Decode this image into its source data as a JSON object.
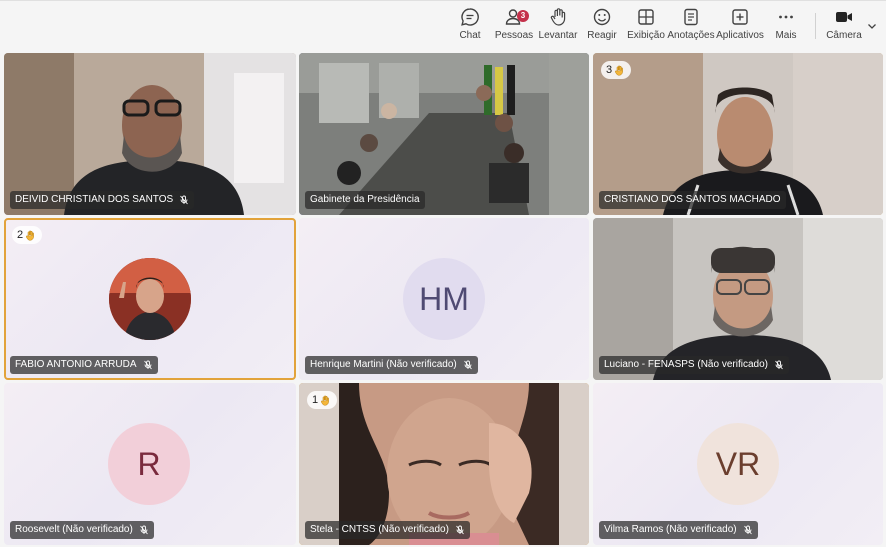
{
  "toolbar": {
    "chat": "Chat",
    "people": "Pessoas",
    "people_badge": "3",
    "raise": "Levantar",
    "react": "Reagir",
    "view": "Exibição",
    "notes": "Anotações",
    "apps": "Aplicativos",
    "more": "Mais",
    "camera": "Câmera"
  },
  "participants": [
    {
      "name": "DEIVID CHRISTIAN DOS SANTOS",
      "muted": true
    },
    {
      "name": "Gabinete da Presidência",
      "muted": false
    },
    {
      "name": "CRISTIANO DOS SANTOS MACHADO",
      "muted": false,
      "raised_hand": "3"
    },
    {
      "name": "FABIO ANTONIO ARRUDA",
      "muted": true,
      "raised_hand": "2"
    },
    {
      "name": "Henrique Martini (Não verificado)",
      "muted": true,
      "initials": "HM"
    },
    {
      "name": "Luciano - FENASPS (Não verificado)",
      "muted": true
    },
    {
      "name": "Roosevelt (Não verificado)",
      "muted": true,
      "initials": "R"
    },
    {
      "name": "Stela - CNTSS (Não verificado)",
      "muted": true,
      "raised_hand": "1"
    },
    {
      "name": "Vilma Ramos (Não verificado)",
      "muted": true,
      "initials": "VR"
    }
  ],
  "colors": {
    "raised_outline": "#e2a33a",
    "active_outline": "#6264a7",
    "badge": "#c4314b"
  }
}
